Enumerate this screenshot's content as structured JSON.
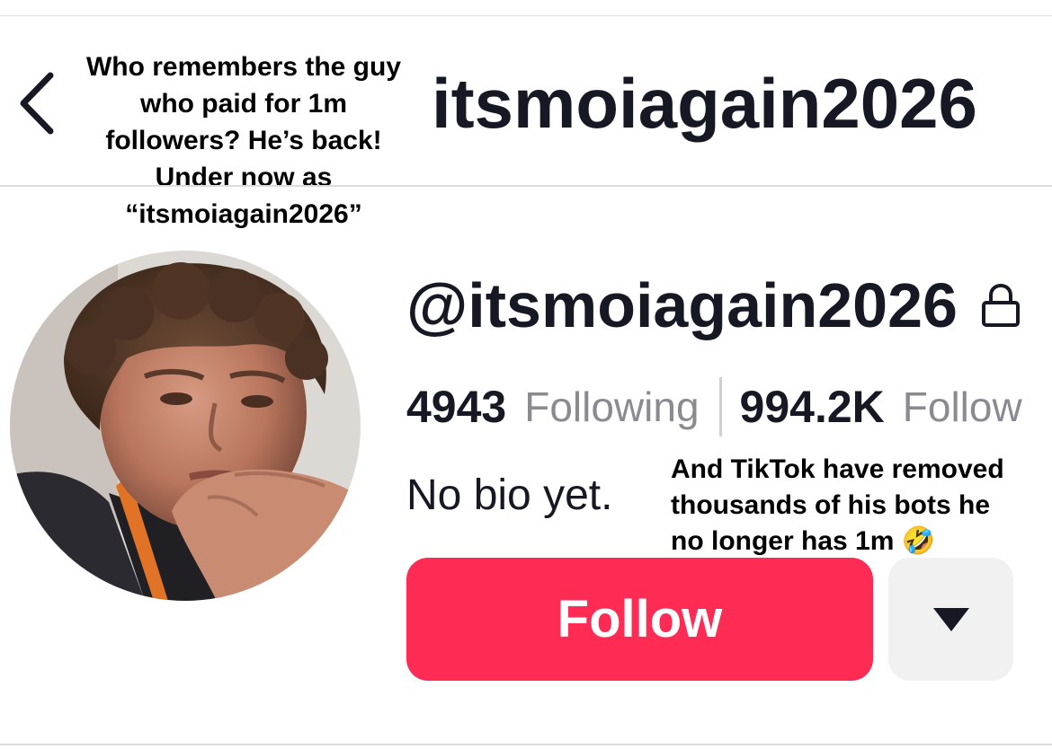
{
  "header": {
    "title": "itsmoiagain2026",
    "back_icon": "chevron-left-icon"
  },
  "captions": {
    "top_lines": [
      "Who remembers the guy",
      "who paid for 1m",
      "followers? He’s back!",
      "Under now as",
      "“itsmoiagain2026”"
    ],
    "side_lines": [
      "And TikTok have removed",
      "thousands of his bots he",
      "no longer has 1m 🤣"
    ]
  },
  "profile": {
    "username": "@itsmoiagain2026",
    "lock_icon": "lock-icon",
    "avatar": "avatar-photo",
    "following_count": "4943",
    "following_label": "Following",
    "followers_count": "994.2K",
    "followers_label": "Follow",
    "bio": "No bio yet."
  },
  "actions": {
    "follow_label": "Follow",
    "more_icon": "caret-down-icon"
  },
  "colors": {
    "follow_button": "#fe2c55",
    "more_button_bg": "#f1f1f2",
    "text_primary": "#161823",
    "text_secondary": "#8a8b91"
  }
}
